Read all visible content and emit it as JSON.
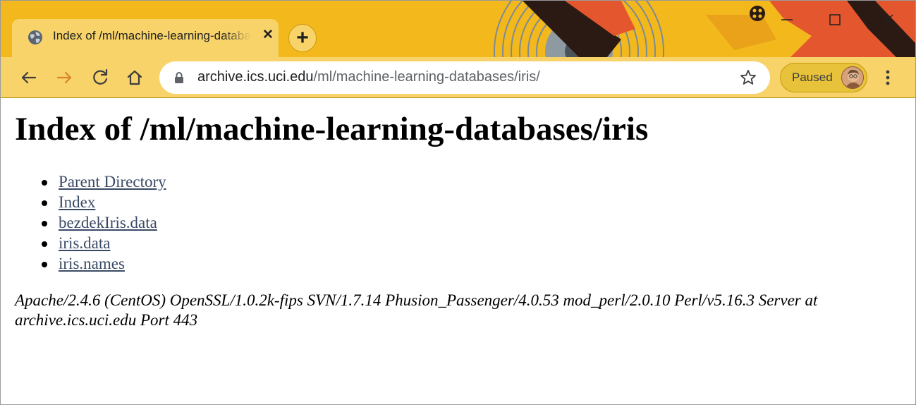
{
  "browser": {
    "tab": {
      "title": "Index of /ml/machine-learning-databases/iris",
      "close_glyph": "✕",
      "favicon": "globe-icon"
    },
    "new_tab_glyph": "+",
    "toolbar": {
      "back_icon": "arrow-left-icon",
      "forward_icon": "arrow-right-icon",
      "reload_icon": "reload-icon",
      "home_icon": "home-icon",
      "url_host": "archive.ics.uci.edu",
      "url_path": "/ml/machine-learning-databases/iris/",
      "lock_icon": "lock-icon",
      "bookmark_icon": "star-icon",
      "profile_status": "Paused",
      "menu_icon": "kebab-menu-icon"
    },
    "window_controls": [
      "minimize-icon",
      "maximize-icon",
      "close-icon"
    ],
    "theme_colors": {
      "frame": "#f3b81c",
      "toolbar": "#f7d36a",
      "art_orange": "#e4572e",
      "art_dark": "#2b1a14"
    }
  },
  "page": {
    "heading": "Index of /ml/machine-learning-databases/iris",
    "links": [
      "Parent Directory",
      "Index",
      "bezdekIris.data",
      "iris.data",
      "iris.names"
    ],
    "signature": "Apache/2.4.6 (CentOS) OpenSSL/1.0.2k-fips SVN/1.7.14 Phusion_Passenger/4.0.53 mod_perl/2.0.10 Perl/v5.16.3 Server at archive.ics.uci.edu Port 443",
    "link_color": "#3a4a66"
  }
}
